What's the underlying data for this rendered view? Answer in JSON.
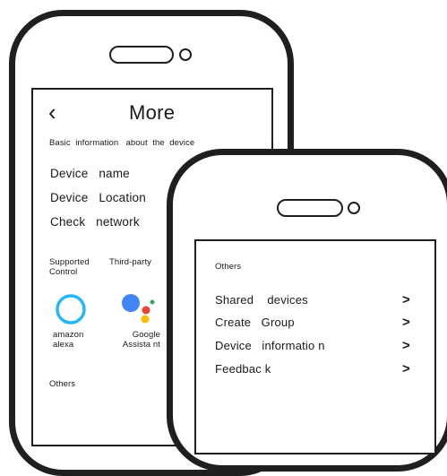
{
  "screen_more": {
    "title": "More",
    "back_icon": "chevron-left-icon",
    "section_basic": "Basic  information   about  the  device",
    "items": [
      {
        "label": "Device   name"
      },
      {
        "label": "Device   Location"
      },
      {
        "label": "Check   network"
      }
    ],
    "section_supported": "Supported\nControl",
    "section_third_party": "Third-party",
    "services": [
      {
        "name": "amazon\nalexa",
        "icon": "alexa-icon"
      },
      {
        "name": "Google\nAssista nt",
        "icon": "google-assistant-icon"
      }
    ],
    "section_others": "Others"
  },
  "screen_others": {
    "section_others": "Others",
    "items": [
      {
        "label": "Shared    devices",
        "chevron": ">"
      },
      {
        "label": "Create   Group",
        "chevron": ">"
      },
      {
        "label": "Device   informatio n",
        "chevron": ">"
      },
      {
        "label": "Feedbac k",
        "chevron": ">"
      }
    ]
  },
  "colors": {
    "outline": "#1f1f1f",
    "alexa_blue": "#29b6f6",
    "google_blue": "#4285f4",
    "google_red": "#ea4335",
    "google_yellow": "#fbbc05",
    "google_green": "#34a853"
  }
}
